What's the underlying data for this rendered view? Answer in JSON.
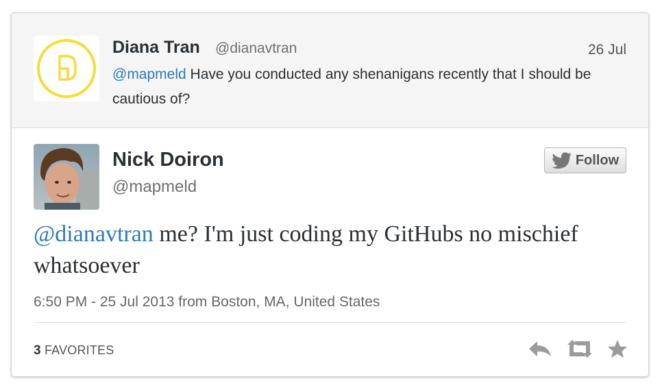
{
  "parent_tweet": {
    "name": "Diana Tran",
    "handle": "@dianavtran",
    "date": "26 Jul",
    "mention": "@mapmeld",
    "text": " Have you conducted any shenanigans recently that I should be cautious of?"
  },
  "main_tweet": {
    "name": "Nick Doiron",
    "handle": "@mapmeld",
    "follow_label": "Follow",
    "mention": "@dianavtran",
    "text": " me? I'm just coding my GitHubs no mischief whatsoever",
    "meta": "6:50 PM - 25 Jul 2013 from Boston, MA, United States",
    "favorites_count": "3",
    "favorites_label": "FAVORITES"
  },
  "icons": {
    "parent_avatar": "yellow-circle-logo-icon",
    "main_avatar": "profile-photo",
    "follow": "twitter-bird-icon",
    "reply": "reply-icon",
    "retweet": "retweet-icon",
    "favorite": "star-icon"
  },
  "colors": {
    "link": "#2b7bb9",
    "logo_yellow": "#f5dc3a",
    "action_icon": "#9b9b9b"
  }
}
